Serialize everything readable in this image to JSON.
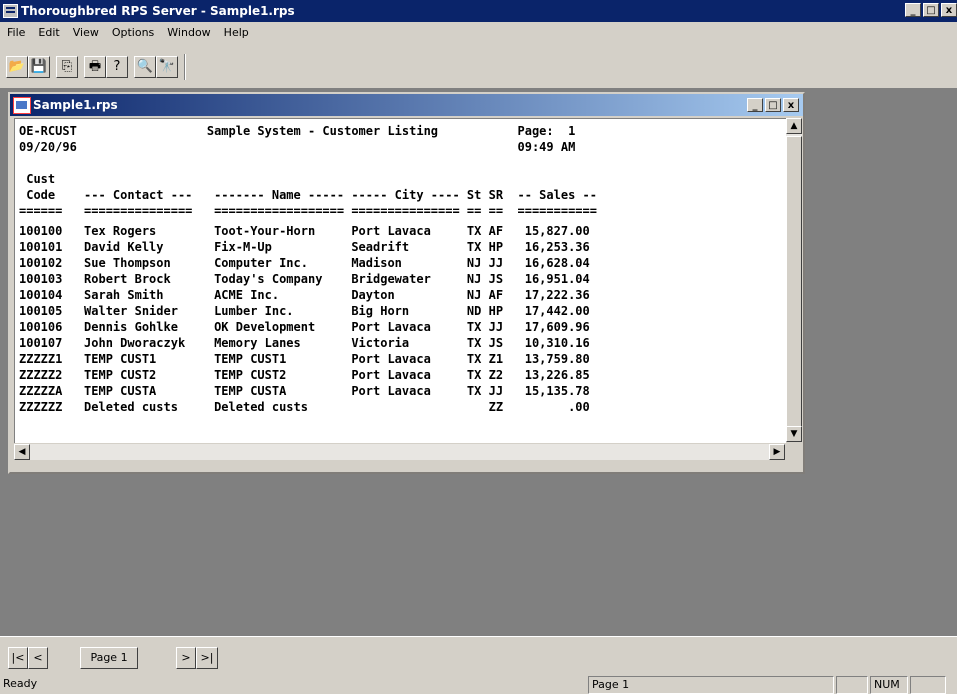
{
  "app": {
    "title": "Thoroughbred RPS Server - Sample1.rps",
    "window_buttons": {
      "minimize": "_",
      "maximize": "□",
      "close": "x"
    }
  },
  "menu": [
    "File",
    "Edit",
    "View",
    "Options",
    "Window",
    "Help"
  ],
  "toolbar": {
    "groups": [
      [
        {
          "icon": "open-folder-icon",
          "glyph": "📂"
        },
        {
          "icon": "save-disk-icon",
          "glyph": "💾"
        }
      ],
      [
        {
          "icon": "copy-icon",
          "glyph": "⎘"
        }
      ],
      [
        {
          "icon": "print-icon",
          "glyph": "🖶"
        },
        {
          "icon": "help-icon",
          "glyph": "?"
        }
      ],
      [
        {
          "icon": "zoom-icon",
          "glyph": "🔍"
        },
        {
          "icon": "find-binoculars-icon",
          "glyph": "🔭"
        }
      ]
    ]
  },
  "document": {
    "title": "Sample1.rps",
    "report_lines": [
      "OE-RCUST                  Sample System - Customer Listing           Page:  1",
      "09/20/96                                                             09:49 AM",
      "",
      " Cust",
      " Code    --- Contact ---   ------- Name ----- ----- City ---- St SR  -- Sales --",
      "======   ===============   ================== =============== == ==  ===========",
      "100100   Tex Rogers        Toot-Your-Horn     Port Lavaca     TX AF   15,827.00",
      "100101   David Kelly       Fix-M-Up           Seadrift        TX HP   16,253.36",
      "100102   Sue Thompson      Computer Inc.      Madison         NJ JJ   16,628.04",
      "100103   Robert Brock      Today's Company    Bridgewater     NJ JS   16,951.04",
      "100104   Sarah Smith       ACME Inc.          Dayton          NJ AF   17,222.36",
      "100105   Walter Snider     Lumber Inc.        Big Horn        ND HP   17,442.00",
      "100106   Dennis Gohlke     OK Development     Port Lavaca     TX JJ   17,609.96",
      "100107   John Dworaczyk    Memory Lanes       Victoria        TX JS   10,310.16",
      "ZZZZZ1   TEMP CUST1        TEMP CUST1         Port Lavaca     TX Z1   13,759.80",
      "ZZZZZ2   TEMP CUST2        TEMP CUST2         Port Lavaca     TX Z2   13,226.85",
      "ZZZZZA   TEMP CUSTA        TEMP CUSTA         Port Lavaca     TX JJ   15,135.78",
      "ZZZZZZ   Deleted custs     Deleted custs                         ZZ         .00"
    ]
  },
  "page_nav": {
    "first": "|<",
    "prev": "<",
    "page_label": "Page 1",
    "next": ">",
    "last": ">|"
  },
  "status": {
    "message": "Ready",
    "page": "Page 1",
    "num": "NUM"
  }
}
